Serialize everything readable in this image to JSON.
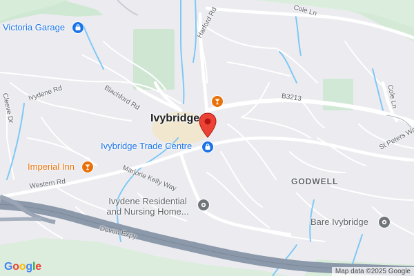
{
  "map": {
    "towns": [
      {
        "name": "Ivybridge"
      }
    ],
    "areas": [
      {
        "name": "GODWELL"
      }
    ],
    "roads": [
      {
        "name": "Cole Ln"
      },
      {
        "name": "Harford Rd"
      },
      {
        "name": "Blachford Rd"
      },
      {
        "name": "Ivydene Rd"
      },
      {
        "name": "Cleeve Dr"
      },
      {
        "name": "B3213"
      },
      {
        "name": "Cole Ln"
      },
      {
        "name": "St Peters Way"
      },
      {
        "name": "Western Rd"
      },
      {
        "name": "Marjorie Kelly Way"
      },
      {
        "name": "Devon Expy"
      }
    ],
    "places": [
      {
        "name": "Victoria Garage",
        "category": "shopping",
        "icon": "shopping-bag-icon",
        "color": "#1a73e8"
      },
      {
        "name": "Ivybridge Trade Centre",
        "category": "shopping",
        "icon": "shopping-bag-icon",
        "color": "#1a73e8"
      },
      {
        "name": "Imperial Inn",
        "category": "bar",
        "icon": "cocktail-icon",
        "color": "#e8710a"
      },
      {
        "name": "",
        "category": "bar",
        "icon": "cocktail-icon",
        "color": "#e8710a"
      },
      {
        "name": "Ivydene Residential and Nursing Home...",
        "category": "establishment",
        "icon": "generic-place-icon",
        "color": "#70757a"
      },
      {
        "name": "Bare Ivybridge",
        "category": "establishment",
        "icon": "generic-place-icon",
        "color": "#70757a"
      }
    ],
    "marker": {
      "icon": "red-location-pin-icon",
      "color": "#ea4335"
    },
    "attribution": "Map data ©2025 Google",
    "logo": "Google"
  }
}
